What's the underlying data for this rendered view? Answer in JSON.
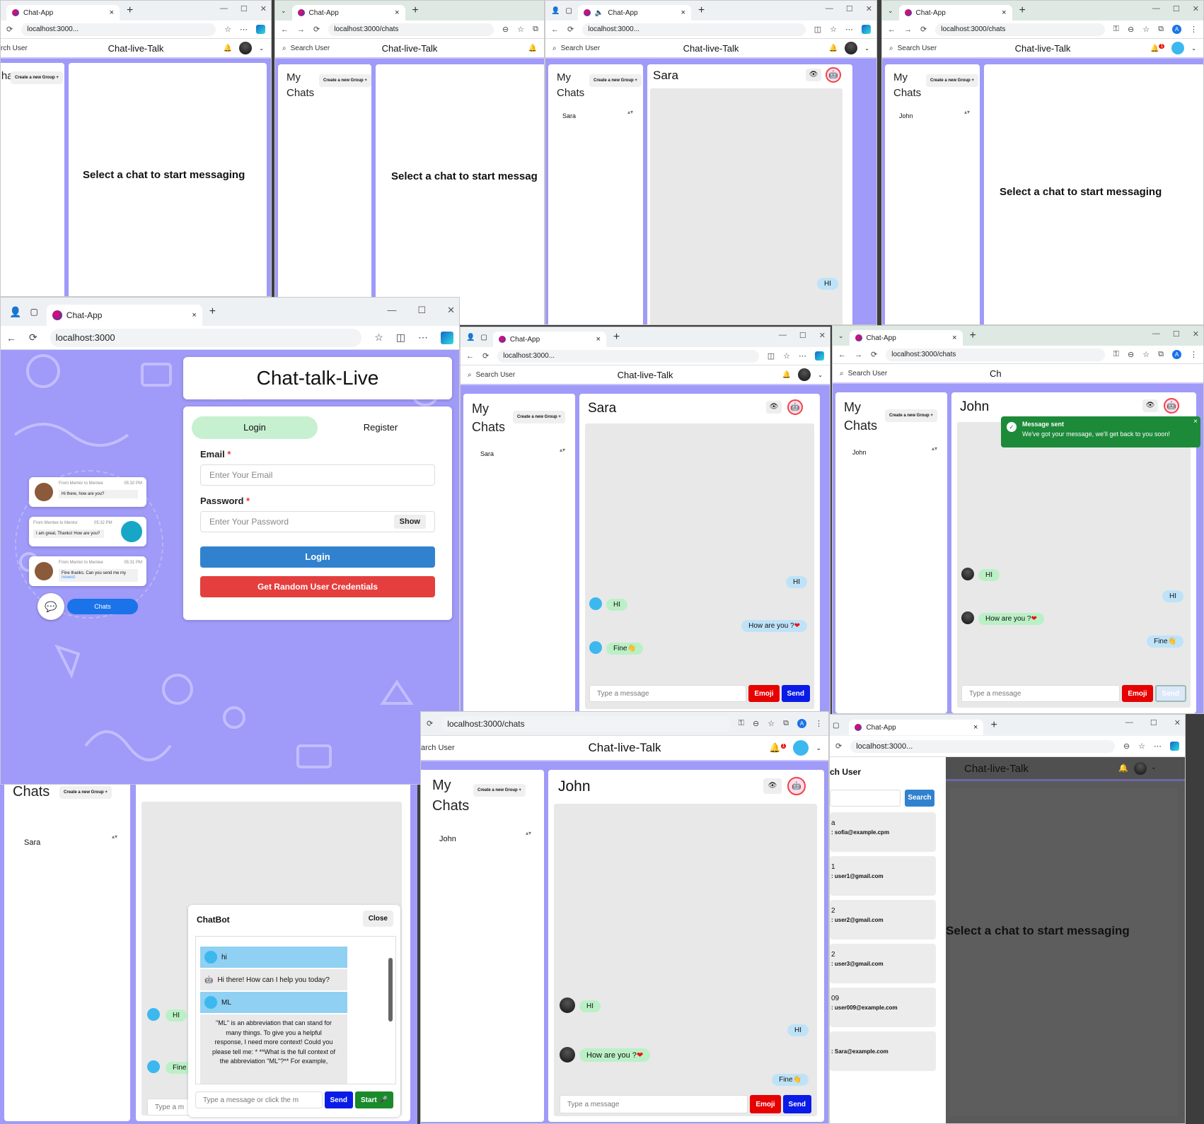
{
  "common": {
    "tab_title": "Chat-App",
    "app_title": "Chat-live-Talk",
    "search_user": "Search User",
    "search_user_cut": "rch User",
    "search_user_cut2": "arch User",
    "search_user_cut3": "ch User",
    "my": "My",
    "chats": "Chats",
    "create_group": "Create a new Group",
    "select_chat": "Select a chat to start messaging",
    "select_chat_cut": "Select a chat to start messag",
    "type_message": "Type a message",
    "type_message_cut": "Type a m",
    "emoji": "Emoji",
    "send": "Send",
    "close_x": "×",
    "plus": "+",
    "url_short": "localhost:3000...",
    "url_chats": "localhost:3000/chats",
    "url_root": "localhost:3000",
    "avatar_letter": "A",
    "notif_count": "1",
    "sort_arrows": "▴▾"
  },
  "contacts": {
    "sara": "Sara",
    "john": "John"
  },
  "messages": {
    "hi": "HI",
    "how_are_you": "How are you ?",
    "fine": "Fine",
    "heart": "❤",
    "hand": "👋"
  },
  "login": {
    "brand": "Chat-talk-Live",
    "tab_login": "Login",
    "tab_register": "Register",
    "email_label": "Email",
    "email_placeholder": "Enter Your Email",
    "password_label": "Password",
    "password_placeholder": "Enter Your Password",
    "show": "Show",
    "login_button": "Login",
    "random_button": "Get Random User Credentials",
    "required_mark": "*",
    "illustration": {
      "m1_meta": "From Mentor to Mentee",
      "m1_time": "05:32 PM",
      "m1_text": "Hi there, how are you?",
      "m2_meta": "From Mentee to Mentor",
      "m2_time": "05:32 PM",
      "m2_text": "I am great, Thanks! How are you?",
      "m3_meta": "From Mentor to Mentee",
      "m3_time": "05:31 PM",
      "m3_text": "Fine thanks. Can you send me my",
      "m3_link": "newest",
      "chats_pill": "Chats"
    }
  },
  "toast": {
    "title": "Message sent",
    "body": "We've got your message, we'll get back to you soon!",
    "brand_cut": "Ch"
  },
  "chatbot": {
    "title": "ChatBot",
    "close": "Close",
    "msg_hi": "hi",
    "bot_reply": "Hi there! How can I help you today?",
    "msg_ml": "ML",
    "bot_long": "\"ML\" is an abbreviation that can stand for many things. To give you a helpful response, I need more context! Could you please tell me: * **What is the full context of the abbreviation \"ML\"?** For example,",
    "input_placeholder": "Type a message or click the m",
    "send": "Send",
    "start": "Start"
  },
  "search_panel": {
    "button": "Search",
    "results": [
      {
        "line1": "a",
        "email": ": sofia@example.cpm"
      },
      {
        "line1": "1",
        "email": ": user1@gmail.com"
      },
      {
        "line1": "2",
        "email": ": user2@gmail.com"
      },
      {
        "line1": "2",
        "email": ": user3@gmail.com"
      },
      {
        "line1": "09",
        "email": ": user009@example.com"
      },
      {
        "line1": "",
        "email": ": Sara@example.com"
      }
    ]
  }
}
